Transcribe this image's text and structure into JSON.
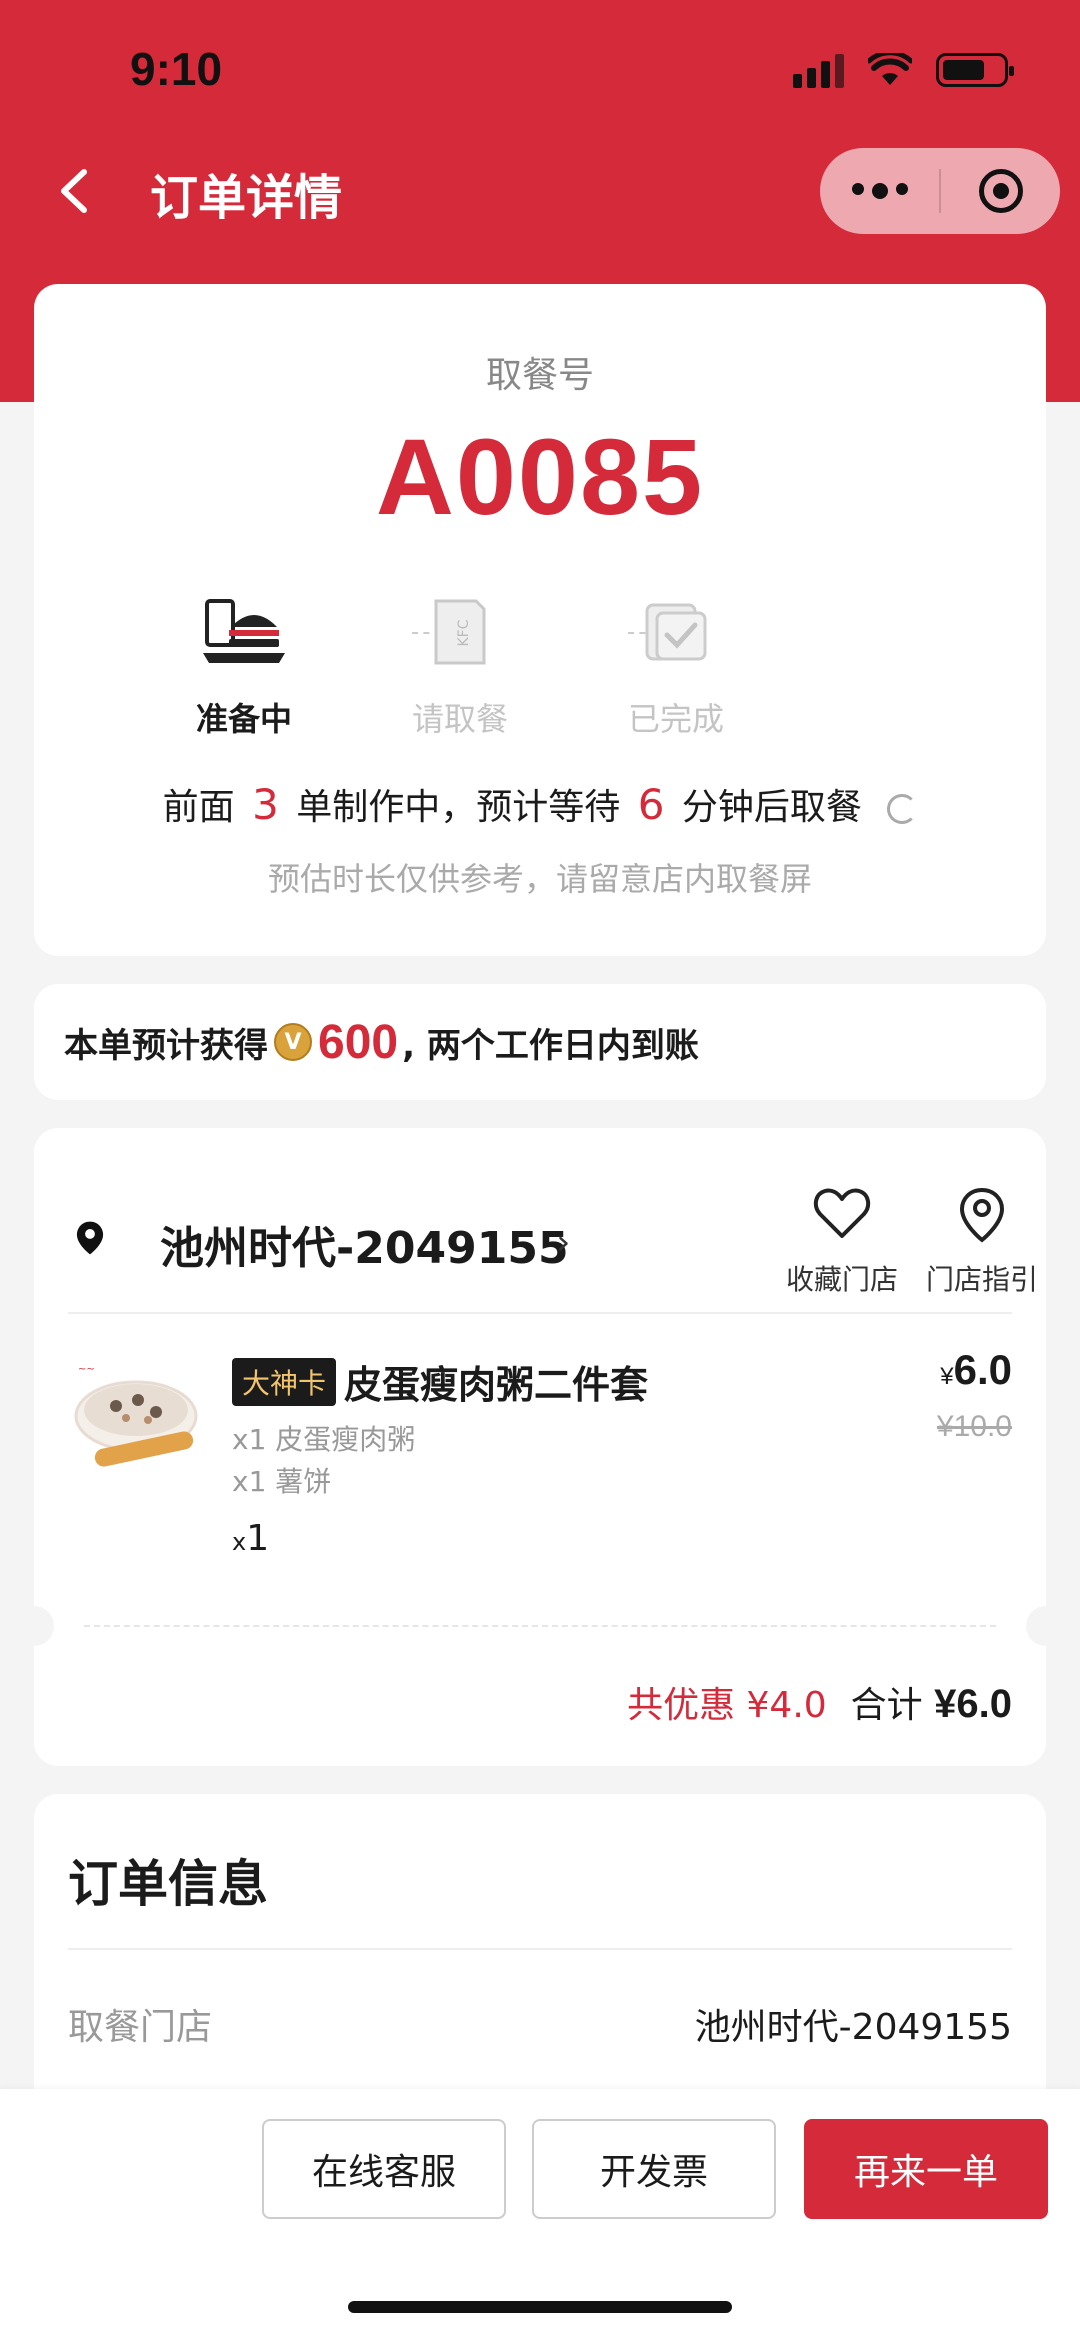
{
  "status_bar": {
    "time": "9:10"
  },
  "nav": {
    "title": "订单详情"
  },
  "pickup": {
    "label": "取餐号",
    "number": "A0085",
    "steps": [
      {
        "label": "准备中",
        "active": true,
        "icon": "food-tray-icon"
      },
      {
        "label": "请取餐",
        "active": false,
        "icon": "kfc-bag-icon"
      },
      {
        "label": "已完成",
        "active": false,
        "icon": "checkmark-cup-icon"
      }
    ],
    "wait": {
      "prefix": "前面",
      "ahead": "3",
      "middle": "单制作中，预计等待",
      "minutes": "6",
      "suffix": "分钟后取餐"
    },
    "note": "预估时长仅供参考，请留意店内取餐屏"
  },
  "points": {
    "prefix": "本单预计获得",
    "coin_letter": "V",
    "amount": "600",
    "suffix": ", 两个工作日内到账"
  },
  "store": {
    "name": "池州时代-2049155",
    "favorite_label": "收藏门店",
    "guide_label": "门店指引"
  },
  "item": {
    "badge": "大神卡",
    "name": "皮蛋瘦肉粥二件套",
    "subs": [
      "x1 皮蛋瘦肉粥",
      "x1 薯饼"
    ],
    "qty_prefix": "x",
    "qty": "1",
    "currency": "¥",
    "price": "6.0",
    "old_price": "¥10.0"
  },
  "totals": {
    "discount": "共优惠 ¥4.0",
    "sum_label": "合计",
    "sum": "¥6.0"
  },
  "order_info": {
    "title": "订单信息",
    "rows": [
      {
        "key": "取餐门店",
        "value": "池州时代-2049155"
      }
    ]
  },
  "actions": {
    "service": "在线客服",
    "invoice": "开发票",
    "reorder": "再来一单"
  },
  "colors": {
    "brand_red": "#d42a3a"
  }
}
